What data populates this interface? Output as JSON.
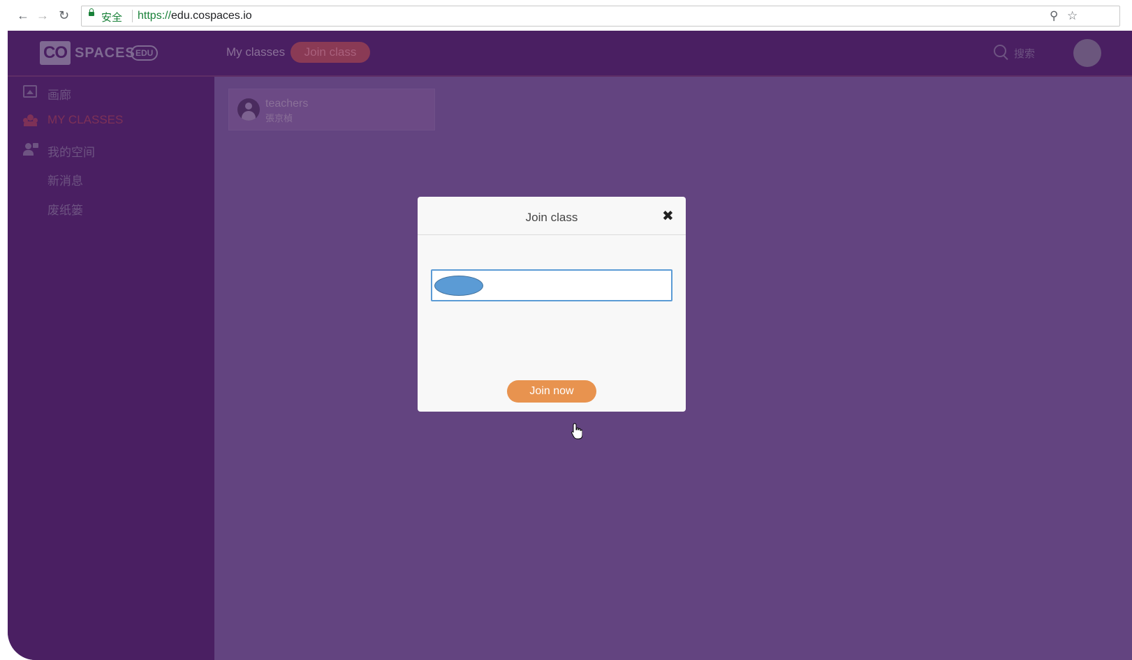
{
  "browser": {
    "security_label": "安全",
    "url_scheme": "https://",
    "url_host": "edu.cospaces.io"
  },
  "header": {
    "logo": {
      "co": "CO",
      "spaces": "SPACES",
      "edu": "EDU"
    },
    "tabs": [
      {
        "label": "My classes"
      }
    ],
    "join_class_button": "Join class",
    "search_label": "搜索"
  },
  "sidebar": {
    "items": [
      {
        "label": "画廊",
        "icon": "gallery-icon",
        "active": false
      },
      {
        "label": "MY CLASSES",
        "icon": "classes-icon",
        "active": true
      },
      {
        "label": "我的空间",
        "icon": "my-space-icon",
        "active": false
      },
      {
        "label": "新消息",
        "icon": "",
        "active": false
      },
      {
        "label": "废纸篓",
        "icon": "",
        "active": false
      }
    ]
  },
  "classes": [
    {
      "name": "teachers",
      "teacher": "張京楨"
    }
  ],
  "modal": {
    "title": "Join class",
    "close_icon": "close-icon",
    "code_input": {
      "value": "",
      "placeholder": ""
    },
    "join_button": "Join now"
  },
  "colors": {
    "topbar": "#4a1f62",
    "main_bg": "#634480",
    "accent": "#e8934f",
    "input_focus": "#5b9bd5"
  }
}
